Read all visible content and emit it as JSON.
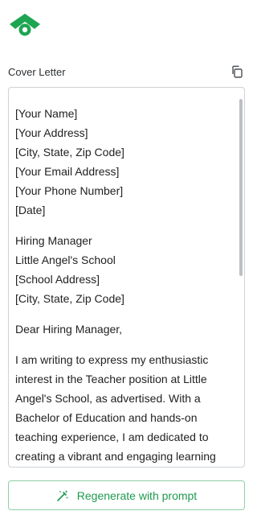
{
  "brand": {
    "color": "#1ea552",
    "logo": "brand-logo-icon"
  },
  "field": {
    "label": "Cover Letter",
    "copy_icon": "copy-icon"
  },
  "letter": {
    "header_lines": [
      "[Your Name]",
      "[Your Address]",
      "[City, State, Zip Code]",
      "[Your Email Address]",
      "[Your Phone Number]",
      "[Date]"
    ],
    "recipient_lines": [
      "Hiring Manager",
      "Little Angel's School",
      "[School Address]",
      "[City, State, Zip Code]"
    ],
    "salutation": "Dear Hiring Manager,",
    "body_lines": [
      "I am writing to express my enthusiastic",
      "interest in the Teacher position at Little",
      "Angel's School, as advertised. With a",
      "Bachelor of Education and hands-on",
      "teaching experience, I am dedicated to",
      "creating a vibrant and engaging learning"
    ]
  },
  "actions": {
    "regenerate_label": "Regenerate with prompt",
    "regenerate_icon": "magic-wand-icon"
  }
}
